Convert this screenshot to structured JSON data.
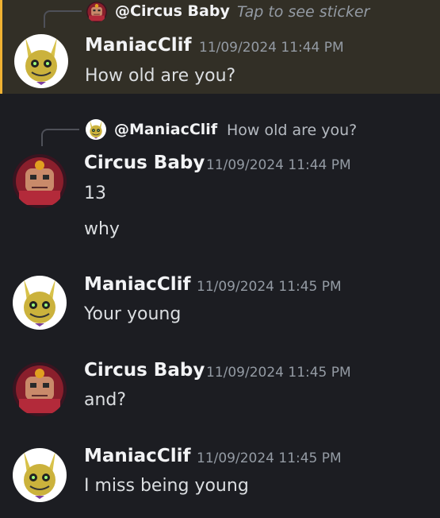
{
  "messages": [
    {
      "author": "ManiacClif",
      "timestamp": "11/09/2024 11:44 PM",
      "lines": [
        "How old are you?"
      ],
      "reply": {
        "author": "@Circus Baby",
        "text": "Tap to see sticker"
      },
      "highlighted": true,
      "avatar": "glitchtrap"
    },
    {
      "author": "Circus Baby",
      "timestamp": "11/09/2024 11:44 PM",
      "lines": [
        "13",
        "why"
      ],
      "reply": {
        "author": "@ManiacClif",
        "text": "How old are you?"
      },
      "avatar": "circus-baby"
    },
    {
      "author": "ManiacClif",
      "timestamp": "11/09/2024 11:45 PM",
      "lines": [
        "Your young"
      ],
      "avatar": "glitchtrap"
    },
    {
      "author": "Circus Baby",
      "timestamp": "11/09/2024 11:45 PM",
      "lines": [
        "and?"
      ],
      "avatar": "circus-baby"
    },
    {
      "author": "ManiacClif",
      "timestamp": "11/09/2024 11:45 PM",
      "lines": [
        "I miss being young"
      ],
      "avatar": "glitchtrap"
    }
  ],
  "colors": {
    "background": "#1c1d22",
    "highlight_background": "#322f26",
    "highlight_bar": "#f0b232",
    "author": "#f2f3f5",
    "timestamp": "#949ba4",
    "text": "#dbdee1"
  }
}
